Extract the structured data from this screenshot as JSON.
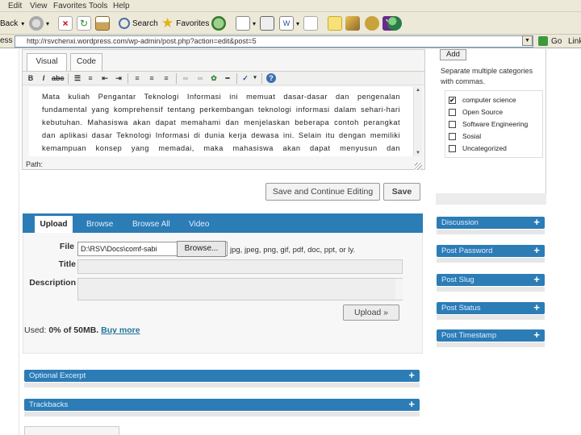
{
  "browser": {
    "menu": [
      "Edit",
      "View",
      "Favorites",
      "Tools",
      "Help"
    ],
    "toolbar": {
      "back_label": "Back",
      "search_label": "Search",
      "favorites_label": "Favorites"
    },
    "address_label": "ess",
    "address_url": "http://rsvchenxi.wordpress.com/wp-admin/post.php?action=edit&post=5",
    "go_label": "Go",
    "links_label": "Links"
  },
  "editor": {
    "tabs": [
      "Visual",
      "Code"
    ],
    "active_tab": "Visual",
    "toolbar_buttons": [
      "bold",
      "italic",
      "strikethrough",
      "bullet-list",
      "numbered-list",
      "outdent",
      "indent",
      "align-left",
      "align-center",
      "align-right",
      "link",
      "unlink",
      "image",
      "more",
      "spellcheck",
      "help"
    ],
    "content": "Mata kuliah Pengantar Teknologi Informasi ini memuat dasar-dasar dan pengenalan fundamental yang komprehensif tentang perkembangan teknologi informasi dalam sehari-hari kebutuhan. Mahasiswa akan dapat memahami dan menjelaskan beberapa contoh perangkat dan aplikasi dasar Teknologi Informasi di dunia kerja dewasa ini. Selain itu dengan memiliki kemampuan konsep yang memadai, maka mahasiswa akan dapat menyusun dan mengevaluasi beberapa contoh mendokumentasikan pemanfaatan dan",
    "path_label": "Path:",
    "save_continue_label": "Save and Continue Editing",
    "save_label": "Save"
  },
  "upload": {
    "tabs": [
      "Upload",
      "Browse",
      "Browse All",
      "Video"
    ],
    "active_tab": "Upload",
    "file_label": "File",
    "file_value": "D:\\RSV\\Docs\\comf-sabi",
    "browse_button": "Browse...",
    "allowed_types": "jpg, jpeg, png, gif, pdf, doc, ppt, or ly.",
    "title_label": "Title",
    "title_value": "",
    "description_label": "Description",
    "description_value": "",
    "upload_button": "Upload »",
    "used_prefix": "Used: ",
    "used_value": "0% of 50MB.",
    "buy_more": "Buy more"
  },
  "left_boxes": [
    {
      "label": "Optional Excerpt"
    },
    {
      "label": "Trackbacks"
    }
  ],
  "categories": {
    "add_button": "Add",
    "help_text": "Separate multiple categories with commas.",
    "items": [
      {
        "label": "computer science",
        "checked": true,
        "mark": "✔"
      },
      {
        "label": "Open Source",
        "checked": false,
        "mark": ""
      },
      {
        "label": "Software Engineering",
        "checked": false,
        "mark": ""
      },
      {
        "label": "Sosial",
        "checked": false,
        "mark": ""
      },
      {
        "label": "Uncategorized",
        "checked": false,
        "mark": ""
      }
    ]
  },
  "side_boxes": [
    {
      "label": "Discussion"
    },
    {
      "label": "Post Password"
    },
    {
      "label": "Post Slug"
    },
    {
      "label": "Post Status"
    },
    {
      "label": "Post Timestamp"
    }
  ],
  "colors": {
    "panel_blue": "#2c7cb6",
    "link_blue": "#21759b",
    "chrome": "#ece9d8"
  }
}
